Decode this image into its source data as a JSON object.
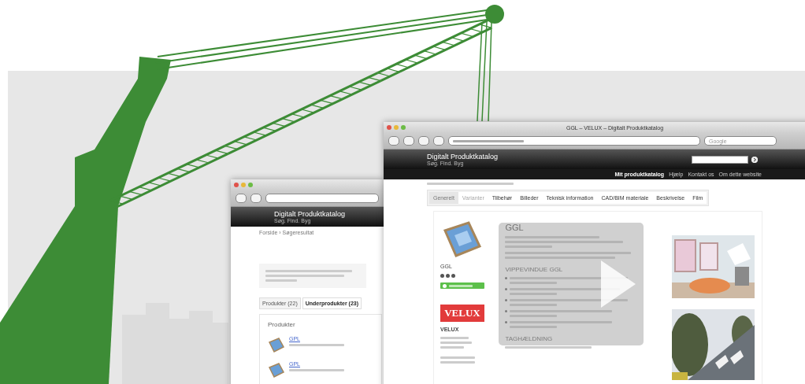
{
  "back_window": {
    "header": {
      "title": "Digitalt Produktkatalog",
      "tagline": "Søg. Find. Byg"
    },
    "breadcrumb": "Forside › Søgeresultat",
    "tabs": [
      {
        "label": "Produkter (22)",
        "selected": false
      },
      {
        "label": "Underprodukter (23)",
        "selected": true
      }
    ],
    "section_title": "Produkter",
    "items": [
      {
        "name": "GPL"
      },
      {
        "name": "GPL"
      }
    ]
  },
  "front_window": {
    "title": "GGL – VELUX – Digitalt Produktkatalog",
    "search_placeholder": "Google",
    "header": {
      "title": "Digitalt Produktkatalog",
      "tagline": "Søg. Find. Byg"
    },
    "nav": [
      {
        "label": "Mit produktkatalog",
        "bold": true
      },
      {
        "label": "Hjælp",
        "bold": false
      },
      {
        "label": "Kontakt os",
        "bold": false
      },
      {
        "label": "Om dette website",
        "bold": false
      }
    ],
    "tabs": [
      {
        "label": "Generelt",
        "selected": true,
        "disabled": false
      },
      {
        "label": "Varianter",
        "selected": false,
        "disabled": true
      },
      {
        "label": "Tilbehør",
        "selected": false,
        "disabled": false
      },
      {
        "label": "Billeder",
        "selected": false,
        "disabled": false
      },
      {
        "label": "Teknisk information",
        "selected": false,
        "disabled": false
      },
      {
        "label": "CAD/BIM materiale",
        "selected": false,
        "disabled": false
      },
      {
        "label": "Beskrivelse",
        "selected": false,
        "disabled": false
      },
      {
        "label": "Film",
        "selected": false,
        "disabled": false
      }
    ],
    "product": {
      "code": "GGL",
      "stars": 3,
      "brand_logo": "VELUX",
      "company": "VELUX",
      "title": "GGL",
      "headings": [
        "VIPPEVINDUE GGL",
        "TAGHÆLDNING"
      ]
    }
  }
}
